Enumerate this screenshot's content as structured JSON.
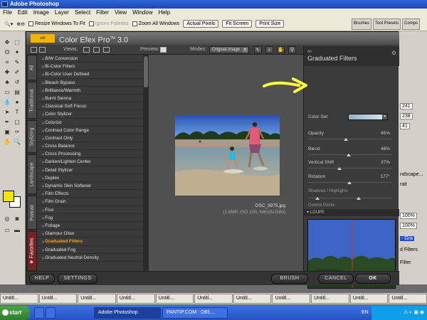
{
  "window": {
    "title": "Adobe Photoshop"
  },
  "menubar": [
    "File",
    "Edit",
    "Image",
    "Layer",
    "Select",
    "Filter",
    "View",
    "Window",
    "Help"
  ],
  "options_bar": {
    "resize_windows": "Resize Windows To Fit",
    "ignore_palettes": "Ignore Palettes",
    "zoom_all": "Zoom All Windows",
    "actual_pixels": "Actual Pixels",
    "fit_screen": "Fit Screen",
    "print_size": "Print Size"
  },
  "palette_tabs": [
    "Brushes",
    "Tool Presets",
    "Comps"
  ],
  "plugin": {
    "title": "Color Efex Pro",
    "tm": "TM",
    "version": "3.0",
    "views_label": "Views:",
    "preview_label": "Preview:",
    "modes_label": "Modes:",
    "mode_value": "Original Image",
    "category_tabs": [
      "All",
      "Traditional",
      "Stylizing",
      "Landscape",
      "Portrait",
      "Favorites"
    ],
    "filters": [
      "B/W Conversion",
      "Bi-Color Filters",
      "Bi-Color User Defined",
      "Bleach Bypass",
      "Brilliance/Warmth",
      "Burnt Sienna",
      "Classical Soft Focus",
      "Color Stylizer",
      "Colorize",
      "Contrast Color Range",
      "Contrast Only",
      "Cross Balance",
      "Cross Processing",
      "Darken/Lighten Center",
      "Detail Stylizer",
      "Duplex",
      "Dynamic Skin Softener",
      "Film Effects",
      "Film Grain",
      "Flux",
      "Fog",
      "Foliage",
      "Glamour Glow",
      "Graduated Filters",
      "Graduated Fog",
      "Graduated Neutral Density"
    ],
    "selected_filter_index": 23,
    "photo_filename": "DSC_9975.jpg",
    "photo_info": "(1.6MP, ISO 100, NIKON D80)",
    "panel": {
      "category": "All",
      "filter_name": "Graduated Filters",
      "color_set_label": "Color Set",
      "controls": [
        {
          "label": "Opacity",
          "value": "45%",
          "level": 0.45
        },
        {
          "label": "Blend",
          "value": "48%",
          "level": 0.48
        },
        {
          "label": "Vertical Shift",
          "value": "37%",
          "level": 0.37
        },
        {
          "label": "Rotation",
          "value": "177°",
          "level": 0.49
        }
      ],
      "shadows_highlights": "Shadows / Highlights",
      "control_points": "Control Points",
      "loupe_label": "LOUPE"
    },
    "buttons": {
      "help": "HELP",
      "settings": "SETTINGS",
      "brush": "BRUSH",
      "cancel": "CANCEL",
      "ok": "OK"
    }
  },
  "right_panels": {
    "v1": "241",
    "v2": "238",
    "v3": "41",
    "pct1": "100%",
    "pct2": "100%",
    "txt_landscape": "ndscape...",
    "txt_portrait": "rait",
    "txt_filters": "d Filters",
    "txt_filter": "Filter",
    "txt_gr": "- Gra"
  },
  "taskbar_row": [
    "Untitl...",
    "Untitl...",
    "Untitl...",
    "Untitl...",
    "Untitl...",
    "Untitl...",
    "Untitl...",
    "Untitl...",
    "Untitl...",
    "Untitl...",
    "Untitl..."
  ],
  "taskbar": {
    "start": "start",
    "items": [
      "Adobe Photoshop",
      "PANTIP.COM : O65..."
    ],
    "lang": "EN"
  },
  "colors": {
    "accent": "#f5a300",
    "annotation": "#ffff3c",
    "fg_swatch": "#f5e600"
  }
}
